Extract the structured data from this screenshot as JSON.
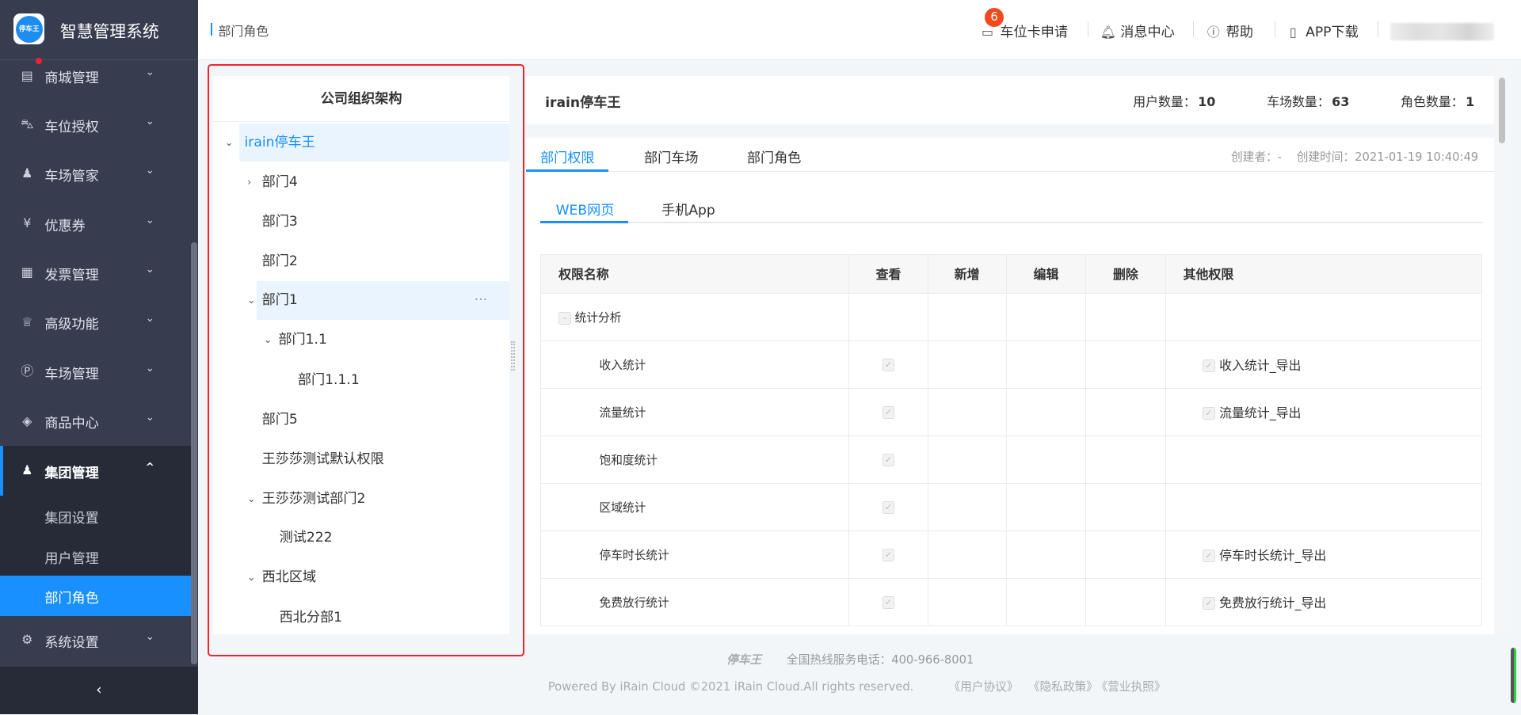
{
  "app": {
    "title": "智慧管理系统",
    "logo_text": "停车王"
  },
  "sidebar": {
    "items": [
      {
        "label": "商城管理",
        "icon": "store-icon"
      },
      {
        "label": "车位授权",
        "icon": "car-icon"
      },
      {
        "label": "车场管家",
        "icon": "user-icon"
      },
      {
        "label": "优惠券",
        "icon": "coupon-icon"
      },
      {
        "label": "发票管理",
        "icon": "invoice-icon"
      },
      {
        "label": "高级功能",
        "icon": "crown-icon"
      },
      {
        "label": "车场管理",
        "icon": "parking-icon"
      },
      {
        "label": "商品中心",
        "icon": "layers-icon"
      },
      {
        "label": "集团管理",
        "icon": "group-icon"
      },
      {
        "label": "系统设置",
        "icon": "gear-icon"
      }
    ],
    "sub_items": [
      "集团设置",
      "用户管理",
      "部门角色"
    ],
    "collapse": "‹"
  },
  "header": {
    "breadcrumb": "部门角色",
    "badge": "6",
    "parking_card": "车位卡申请",
    "messages": "消息中心",
    "help": "帮助",
    "app_download": "APP下载"
  },
  "tree": {
    "title": "公司组织架构",
    "nodes": [
      "irain停车王",
      "部门4",
      "部门3",
      "部门2",
      "部门1",
      "部门1.1",
      "部门1.1.1",
      "部门5",
      "王莎莎测试默认权限",
      "王莎莎测试部门2",
      "测试222",
      "西北区域",
      "西北分部1"
    ],
    "more": "···"
  },
  "info": {
    "name": "irain停车王",
    "users_label": "用户数量：",
    "users": "10",
    "lots_label": "车场数量：",
    "lots": "63",
    "roles_label": "角色数量：",
    "roles": "1"
  },
  "tabs": [
    "部门权限",
    "部门车场",
    "部门角色"
  ],
  "meta": {
    "creator": "创建者：-",
    "created": "创建时间：2021-01-19 10:40:49"
  },
  "subtabs": [
    "WEB网页",
    "手机App"
  ],
  "table": {
    "headers": [
      "权限名称",
      "查看",
      "新增",
      "编辑",
      "删除",
      "其他权限"
    ],
    "group": "统计分析",
    "rows": [
      {
        "name": "收入统计",
        "other": "收入统计_导出"
      },
      {
        "name": "流量统计",
        "other": "流量统计_导出"
      },
      {
        "name": "饱和度统计",
        "other": ""
      },
      {
        "name": "区域统计",
        "other": ""
      },
      {
        "name": "停车时长统计",
        "other": "停车时长统计_导出"
      },
      {
        "name": "免费放行统计",
        "other": "免费放行统计_导出"
      }
    ]
  },
  "footer": {
    "logo": "停车王",
    "hotline": "全国热线服务电话：400-966-8001",
    "copyright": "Powered By iRain Cloud ©2021 iRain Cloud.All rights reserved.",
    "links": [
      "《用户协议》",
      "《隐私政策》",
      "《营业执照》"
    ]
  }
}
